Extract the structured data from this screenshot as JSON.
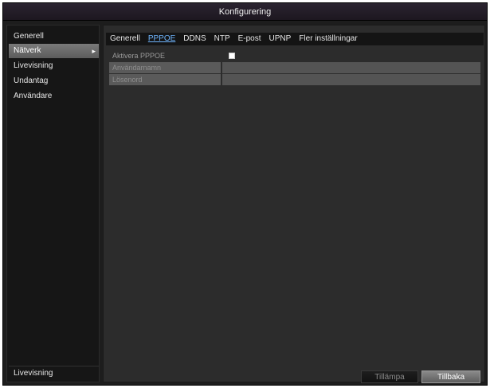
{
  "window": {
    "title": "Konfigurering"
  },
  "sidebar": {
    "items": [
      {
        "label": "Generell"
      },
      {
        "label": "Nätverk",
        "arrow": "▸"
      },
      {
        "label": "Livevisning"
      },
      {
        "label": "Undantag"
      },
      {
        "label": "Användare"
      }
    ],
    "bottom_label": "Livevisning"
  },
  "tabs": [
    {
      "label": "Generell"
    },
    {
      "label": "PPPOE",
      "active": true
    },
    {
      "label": "DDNS"
    },
    {
      "label": "NTP"
    },
    {
      "label": "E-post"
    },
    {
      "label": "UPNP"
    },
    {
      "label": "Fler inställningar"
    }
  ],
  "form": {
    "enable_label": "Aktivera PPPOE",
    "enable_checked": true,
    "username_label": "Användarnamn",
    "username_value": "",
    "password_label": "Lösenord",
    "password_value": ""
  },
  "buttons": {
    "apply": "Tillämpa",
    "back": "Tillbaka"
  }
}
